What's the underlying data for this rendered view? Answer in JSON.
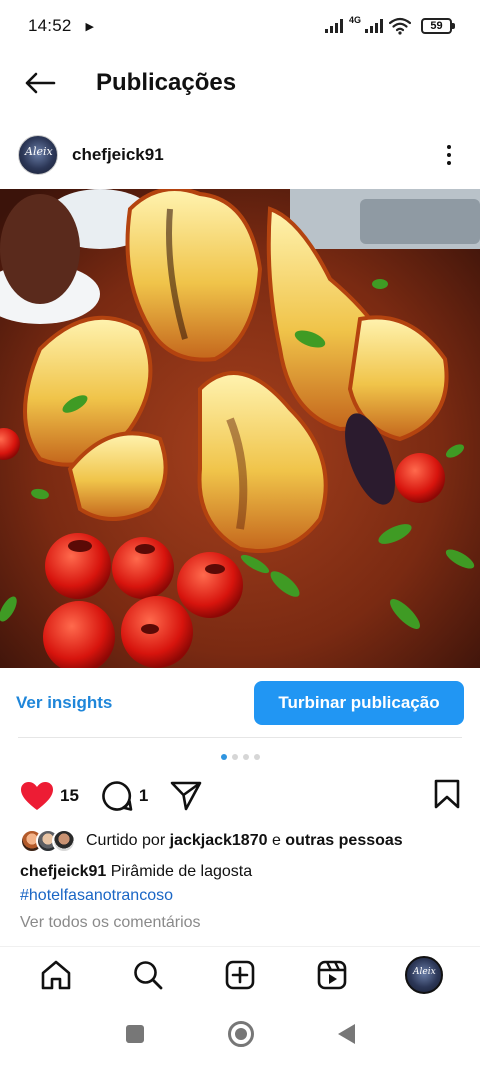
{
  "status_bar": {
    "time": "14:52",
    "network": "4G",
    "battery": "59"
  },
  "header": {
    "title": "Publicações"
  },
  "post": {
    "author": "chefjeick91",
    "avatar_text": "Aleix",
    "insights_label": "Ver insights",
    "boost_label": "Turbinar publicação",
    "carousel": {
      "count": 4,
      "active": 1
    },
    "likes_count": "15",
    "comments_count": "1",
    "liked_by_prefix": "Curtido por",
    "liked_by_user": "jackjack1870",
    "liked_by_joiner": "e",
    "liked_by_others": "outras pessoas",
    "caption_author": "chefjeick91",
    "caption_text": "Pirâmide de lagosta",
    "hashtag": "#hotelfasanotrancoso",
    "view_comments": "Ver todos os comentários"
  },
  "colors": {
    "accent": "#2196f3",
    "link": "#1f86d9",
    "hashtag": "#1a66c5",
    "like": "#ed1c34"
  }
}
